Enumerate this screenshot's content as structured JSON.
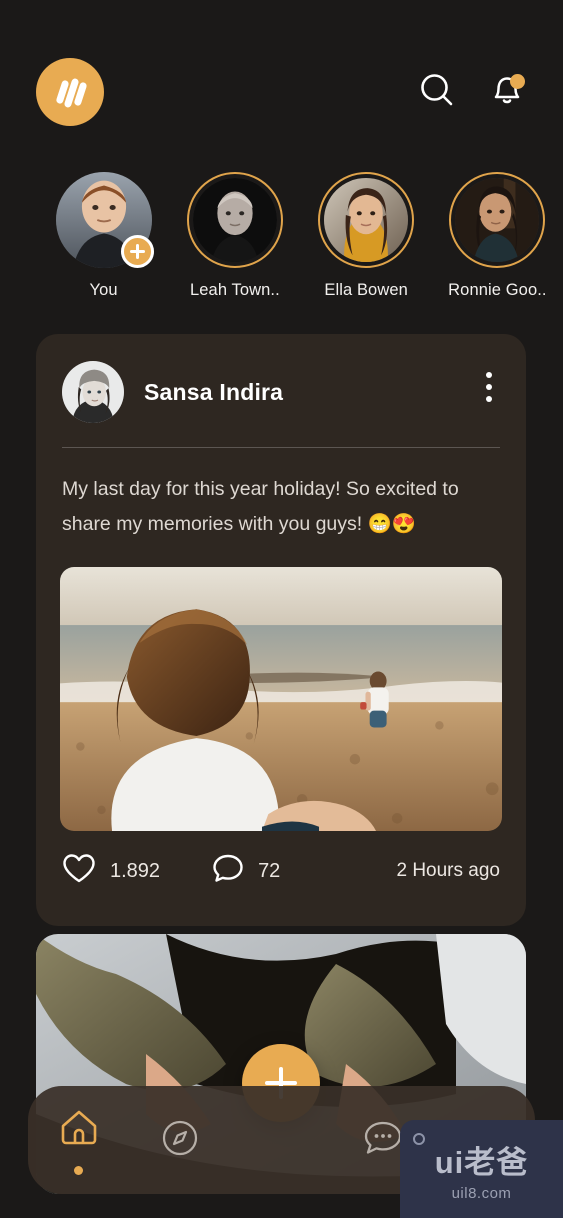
{
  "app": {
    "background_color": "#1b1918",
    "accent_color": "#e8ab52",
    "card_color": "#2e2721"
  },
  "header": {
    "logo_name": "app-logo",
    "search_icon": "search-icon",
    "notification_icon": "bell-icon",
    "notification_dot": true
  },
  "stories": [
    {
      "name": "You",
      "has_ring": false,
      "has_add_badge": true
    },
    {
      "name": "Leah Town..",
      "has_ring": true,
      "has_add_badge": false
    },
    {
      "name": "Ella Bowen",
      "has_ring": true,
      "has_add_badge": false
    },
    {
      "name": "Ronnie Goo..",
      "has_ring": true,
      "has_add_badge": false
    }
  ],
  "post": {
    "author": "Sansa Indira",
    "menu_icon": "more-vertical-icon",
    "text": "My last day for this year holiday! So excited to share my memories with you guys! 😁😍",
    "image_alt": "woman sitting on beach watching child near the ocean at sunset",
    "like_icon": "heart-icon",
    "likes": "1.892",
    "comment_icon": "comment-icon",
    "comments": "72",
    "timestamp": "2 Hours ago"
  },
  "post2": {
    "image_alt": "close-up of arms in olive green jacket"
  },
  "bottom_nav": {
    "items": [
      {
        "icon": "home-icon",
        "active": true
      },
      {
        "icon": "compass-icon",
        "active": false
      },
      {
        "icon": "chat-icon",
        "active": false
      },
      {
        "icon": "profile-icon",
        "active": false
      }
    ],
    "fab_icon": "plus-icon"
  },
  "watermark": {
    "main": "ui老爸",
    "sub": "uil8.com"
  }
}
